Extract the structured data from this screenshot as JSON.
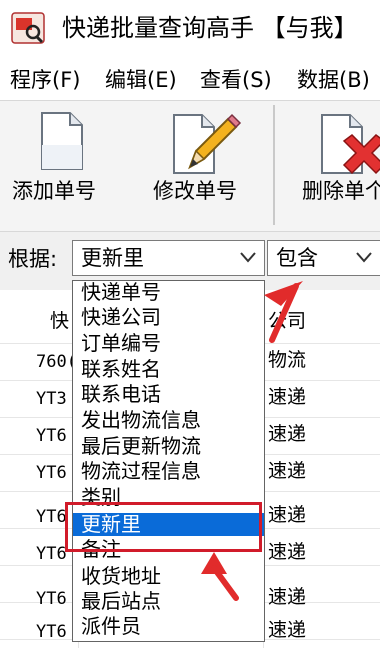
{
  "window": {
    "title": "快递批量查询高手 【与我】",
    "app_icon": "app-logo-icon"
  },
  "menu": {
    "items": [
      "程序(F)",
      "编辑(E)",
      "查看(S)",
      "数据(B)"
    ]
  },
  "toolbar": {
    "add": "添加单号",
    "edit": "修改单号",
    "delete": "删除单个"
  },
  "filter": {
    "label": "根据:",
    "field_selected": "更新里",
    "match_selected": "包含"
  },
  "dropdown": {
    "options": [
      "快递单号",
      "快递公司",
      "订单编号",
      "联系姓名",
      "联系电话",
      "发出物流信息",
      "最后更新物流",
      "物流过程信息",
      "类别",
      "更新里",
      "备注",
      "收货地址",
      "最后站点",
      "派件员"
    ],
    "selected_index": 9
  },
  "grid": {
    "headers": [
      "快",
      "公司"
    ],
    "rows": [
      [
        "760(",
        "物流"
      ],
      [
        "YT3",
        "速递"
      ],
      [
        "YT6",
        "速递"
      ],
      [
        "YT6",
        "速递"
      ],
      [
        "YT6",
        "速递"
      ],
      [
        "YT6",
        "速递"
      ],
      [
        "YT6",
        "速递"
      ],
      [
        "YT6",
        "速递"
      ]
    ]
  },
  "colors": {
    "selection": "#0a6bd8",
    "annotation": "#d11b2a"
  }
}
